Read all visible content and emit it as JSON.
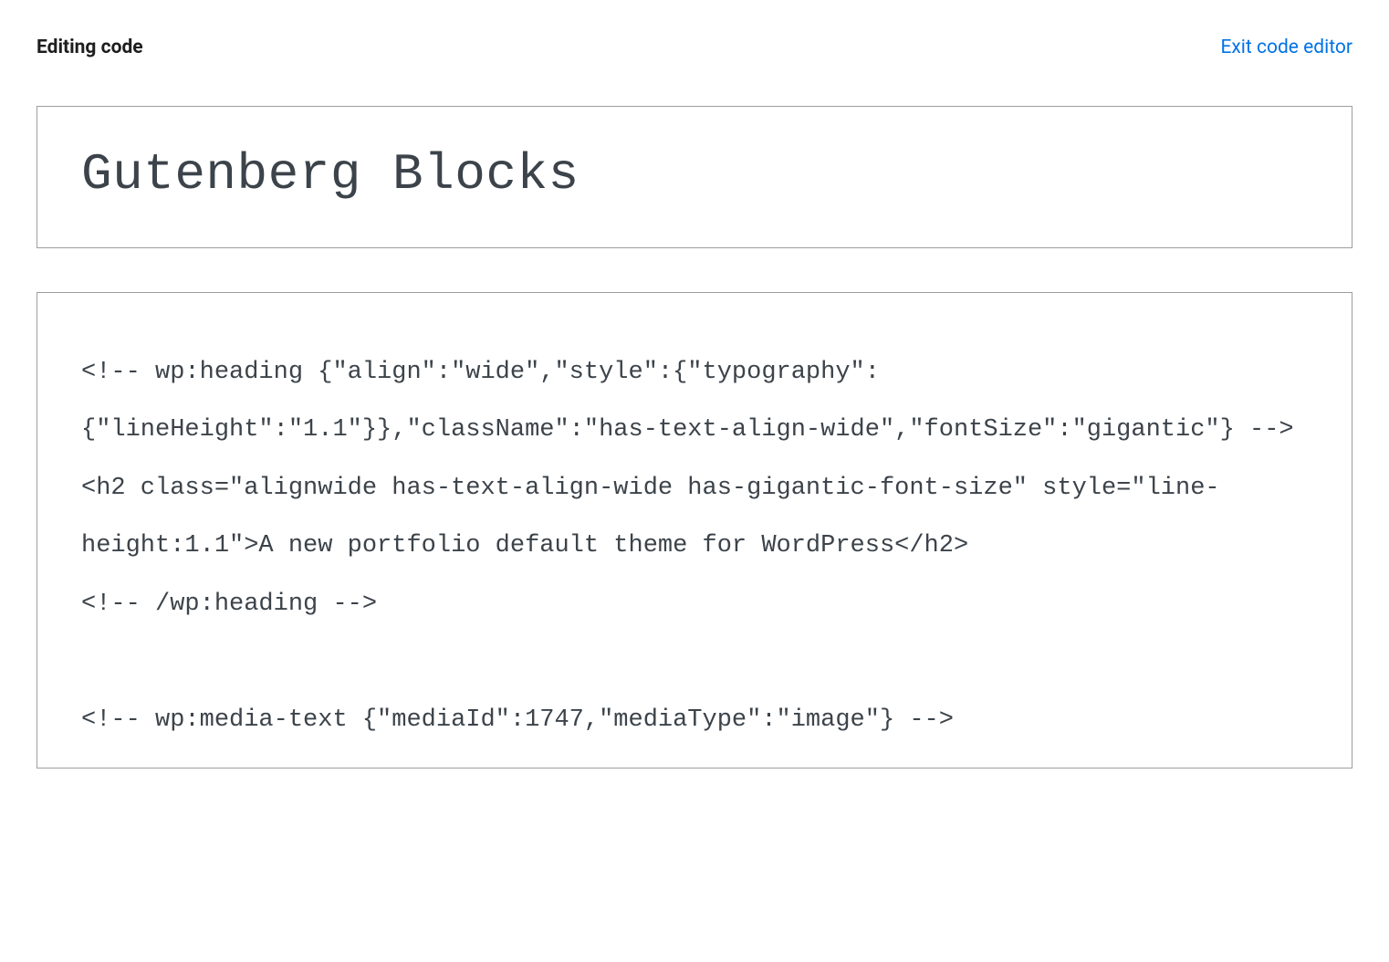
{
  "header": {
    "title": "Editing code",
    "exit_label": "Exit code editor"
  },
  "editor": {
    "title_value": "Gutenberg Blocks",
    "code_value": "<!-- wp:heading {\"align\":\"wide\",\"style\":{\"typography\":{\"lineHeight\":\"1.1\"}},\"className\":\"has-text-align-wide\",\"fontSize\":\"gigantic\"} -->\n<h2 class=\"alignwide has-text-align-wide has-gigantic-font-size\" style=\"line-height:1.1\">A new portfolio default theme for WordPress</h2>\n<!-- /wp:heading -->\n\n<!-- wp:media-text {\"mediaId\":1747,\"mediaType\":\"image\"} -->"
  }
}
